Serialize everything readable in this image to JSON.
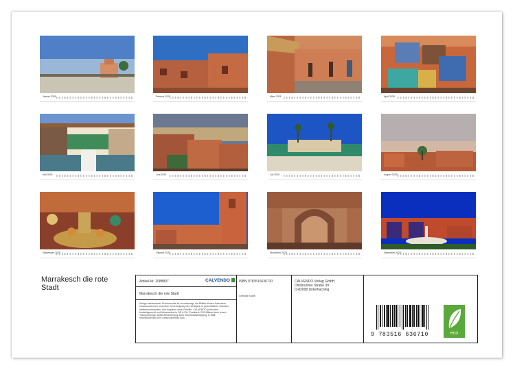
{
  "months": [
    {
      "name": "Januar 2025"
    },
    {
      "name": "Februar 2025"
    },
    {
      "name": "März 2025"
    },
    {
      "name": "April 2025"
    },
    {
      "name": "Mai 2025"
    },
    {
      "name": "Juni 2025"
    },
    {
      "name": "Juli 2025"
    },
    {
      "name": "August 2025"
    },
    {
      "name": "September 2025"
    },
    {
      "name": "Oktober 2025"
    },
    {
      "name": "November 2025"
    },
    {
      "name": "Dezember 2025"
    }
  ],
  "calendar_title": "Marrakesch die rote Stadt",
  "article": "Artikel-Nr. 2088807",
  "publisher_logo": "CALVENDO",
  "product_title": "Marrakesch die rote Stadt",
  "legal_text": "Infolge bestehender Schutzrechte ist es untersagt, die Blätter dieses Kalenders herauszutrennen und ohne Genehmigung des Verlages zu gewerblichen Zwecken weiterzuverwenden. Alle Angaben ohne Gewähr. CALVENDO produziert bedarfsgerecht und klimaneutral in DE & EU. Postkarte CO2-Bilanz dank kurzer Transportwege. Abfall-Reduzierung dank Einzelstückfertigung. E-Mail: info@calvendo.com • www.calvendo.com",
  "isbn": "ISBN 9783516636710",
  "author": "Gerhard Bozek",
  "publisher": "CALVENDO Verlag GmbH",
  "street": "Ottobrunner Straße 39",
  "city": "D-82008 Unterhaching",
  "barcode_number": "9 783516 636710",
  "eco_label": "eco"
}
